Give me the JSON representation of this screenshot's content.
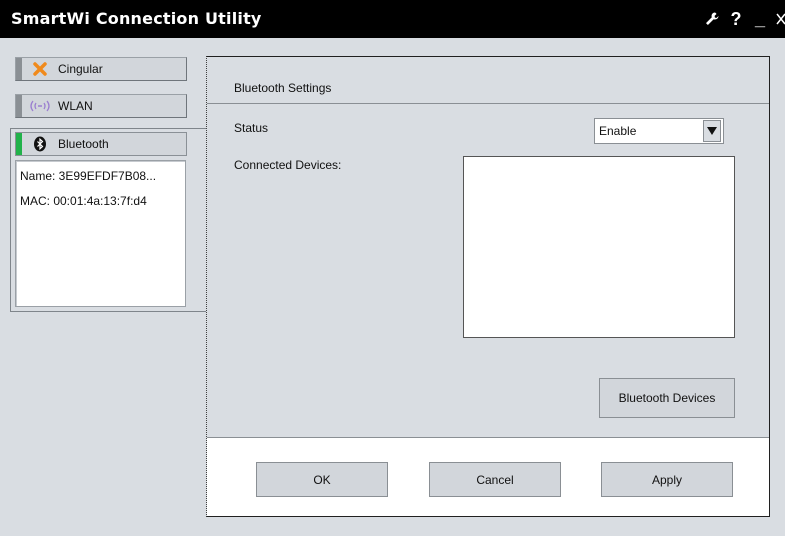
{
  "window": {
    "title": "SmartWi Connection Utility",
    "controls": {
      "settings": "⚒",
      "help": "?",
      "minimize": "_",
      "close": "×"
    }
  },
  "sidebar": {
    "items": [
      {
        "label": "Cingular",
        "icon": "cingular-x-icon",
        "indicator": "gray"
      },
      {
        "label": "WLAN",
        "icon": "wlan-signal-icon",
        "indicator": "gray"
      },
      {
        "label": "Bluetooth",
        "icon": "bluetooth-icon",
        "indicator": "green",
        "active": true
      }
    ],
    "device_info": {
      "name_line": "Name: 3E99EFDF7B08...",
      "mac_line": "MAC:  00:01:4a:13:7f:d4"
    }
  },
  "main": {
    "section_title": "Bluetooth Settings",
    "status_label": "Status",
    "status_value": "Enable",
    "connected_devices_label": "Connected Devices:",
    "connected_devices": [],
    "bluetooth_devices_button": "Bluetooth Devices"
  },
  "footer": {
    "ok": "OK",
    "cancel": "Cancel",
    "apply": "Apply"
  },
  "colors": {
    "titlebar": "#000000",
    "panel": "#d9dde2",
    "active_indicator": "#21b24a",
    "cingular_orange": "#f08a1c",
    "wlan_purple": "#9b7fd0"
  }
}
